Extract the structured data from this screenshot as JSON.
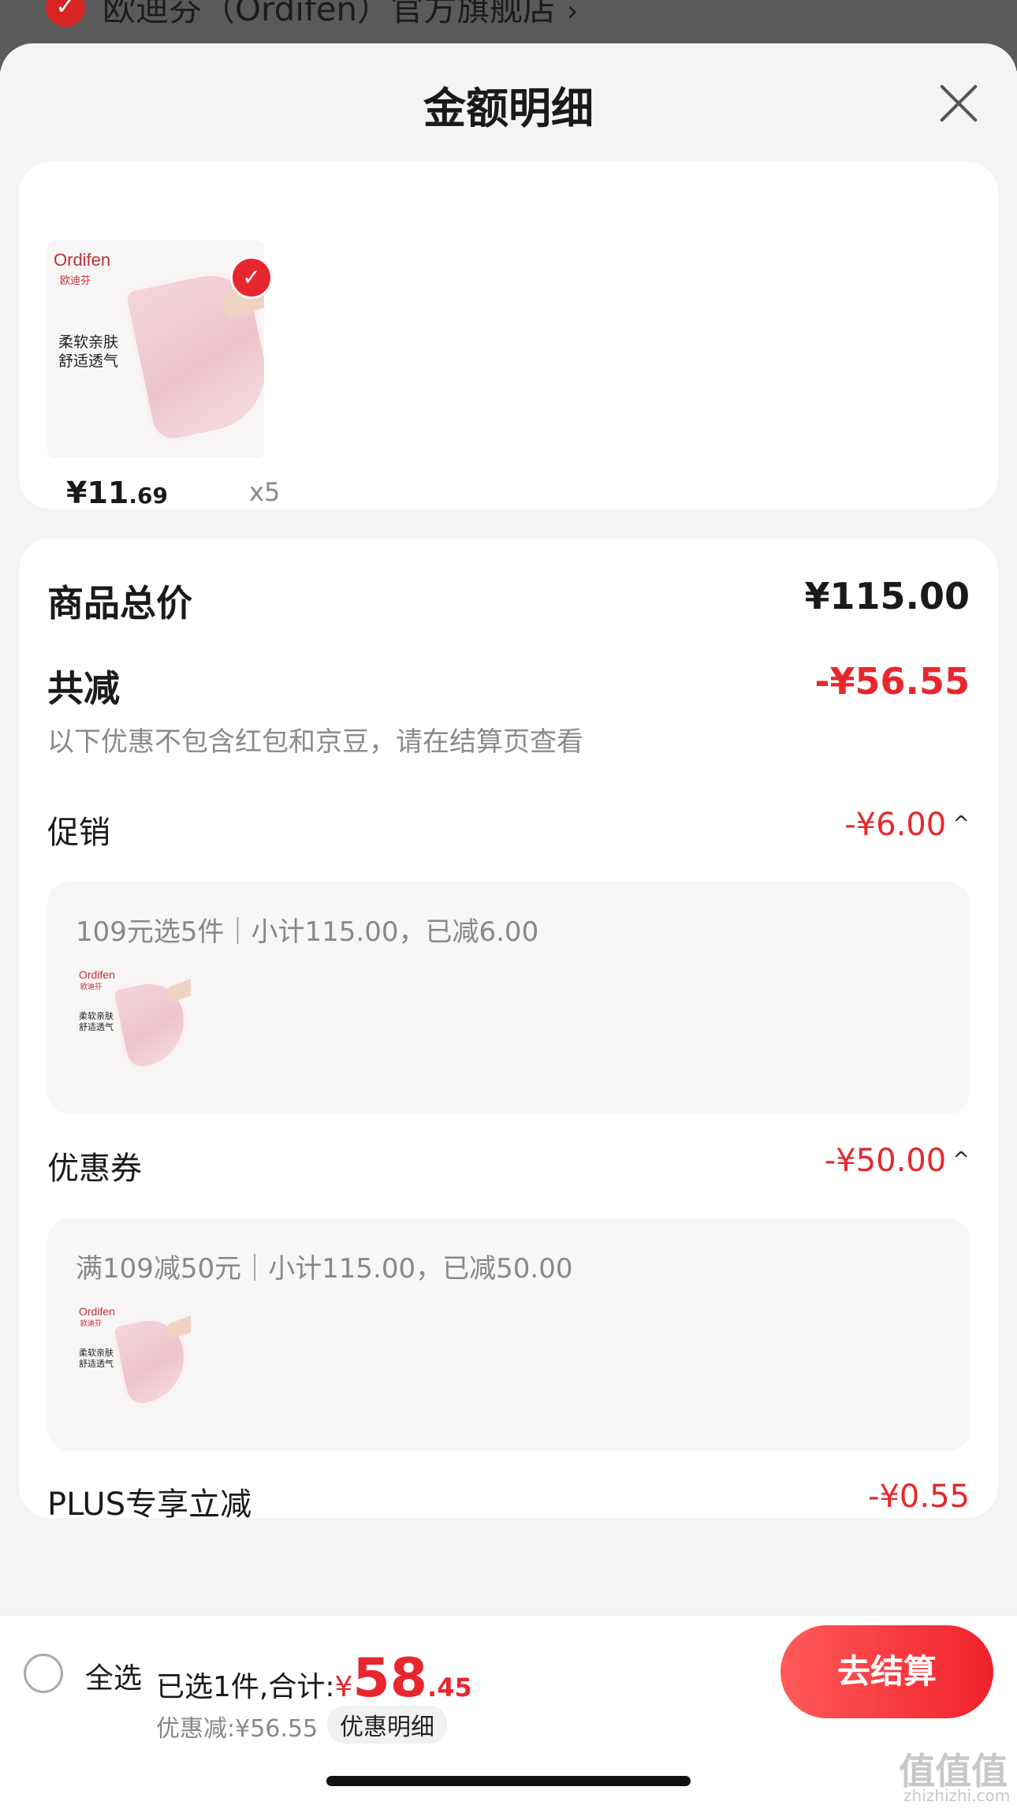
{
  "store": {
    "name": "欧迪芬（Ordifen）官方旗舰店",
    "chevron": "›"
  },
  "sheet": {
    "title": "金额明细",
    "close_icon": "close-icon"
  },
  "product": {
    "brand": "Ordifen",
    "brand_cn": "欧迪芬",
    "tagline_1": "柔软亲肤",
    "tagline_2": "舒适透气",
    "price_yen": "¥11",
    "price_decimal": ".69",
    "quantity": "x5",
    "selected": true
  },
  "detail": {
    "total_label": "商品总价",
    "total_value": "¥115.00",
    "reduce_label": "共减",
    "reduce_value": "-¥56.55",
    "note": "以下优惠不包含红包和京豆，请在结算页查看",
    "promotion": {
      "label": "促销",
      "value": "-¥6.00",
      "caret": "^",
      "rule": "109元选5件｜小计115.00，已减6.00"
    },
    "coupon": {
      "label": "优惠券",
      "value": "-¥50.00",
      "caret": "^",
      "rule": "满109减50元｜小计115.00，已减50.00"
    },
    "plus": {
      "label": "PLUS专享立减",
      "value": "-¥0.55"
    }
  },
  "bottom": {
    "select_all": "全选",
    "summary_prefix": "已选1件,合计:",
    "yen": "¥",
    "amount_int": "58",
    "amount_dec": ".45",
    "discount": "优惠减:¥56.55",
    "detail_link": "优惠明细",
    "checkout": "去结算"
  },
  "watermark": {
    "text": "值值值",
    "sub": "zhizhizhi.com"
  },
  "colors": {
    "accent": "#e8262d",
    "background": "#f4f4f4"
  }
}
